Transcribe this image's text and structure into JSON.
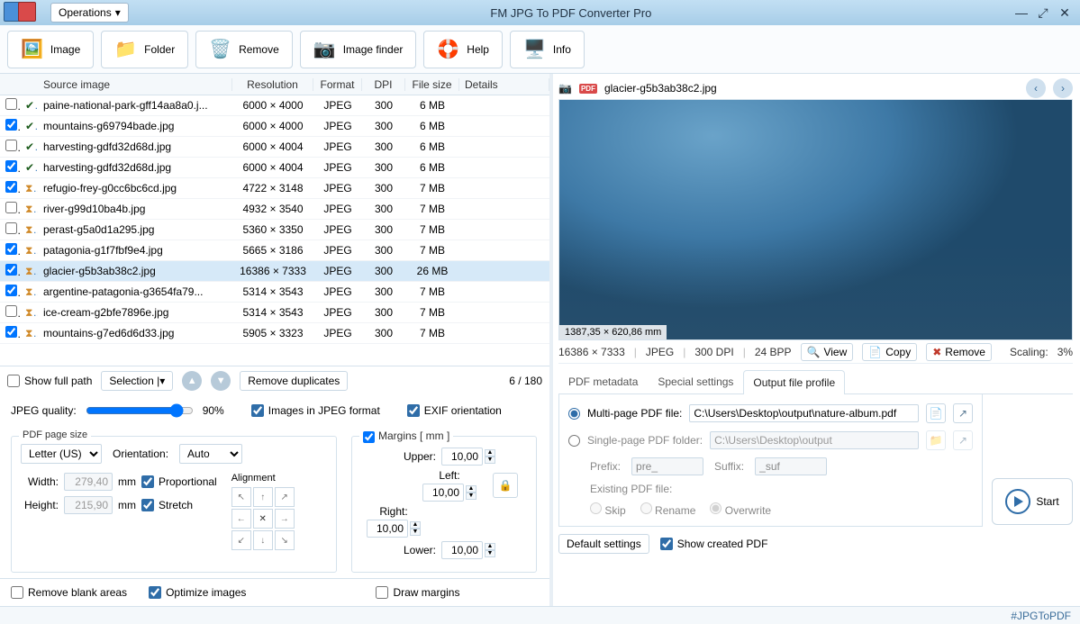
{
  "app": {
    "title": "FM JPG To PDF Converter Pro",
    "operations_btn": "Operations"
  },
  "toolbar": {
    "image": "Image",
    "folder": "Folder",
    "remove": "Remove",
    "finder": "Image finder",
    "help": "Help",
    "info": "Info"
  },
  "columns": {
    "source": "Source image",
    "resolution": "Resolution",
    "format": "Format",
    "dpi": "DPI",
    "size": "File size",
    "details": "Details"
  },
  "rows": [
    {
      "chk": false,
      "dup": true,
      "name": "paine-national-park-gff14aa8a0.j...",
      "res": "6000 × 4000",
      "fmt": "JPEG",
      "dpi": "300",
      "size": "6 MB",
      "sel": false
    },
    {
      "chk": true,
      "dup": true,
      "name": "mountains-g69794bade.jpg",
      "res": "6000 × 4000",
      "fmt": "JPEG",
      "dpi": "300",
      "size": "6 MB",
      "sel": false
    },
    {
      "chk": false,
      "dup": true,
      "name": "harvesting-gdfd32d68d.jpg",
      "res": "6000 × 4004",
      "fmt": "JPEG",
      "dpi": "300",
      "size": "6 MB",
      "sel": false
    },
    {
      "chk": true,
      "dup": true,
      "name": "harvesting-gdfd32d68d.jpg",
      "res": "6000 × 4004",
      "fmt": "JPEG",
      "dpi": "300",
      "size": "6 MB",
      "sel": false
    },
    {
      "chk": true,
      "dup": false,
      "name": "refugio-frey-g0cc6bc6cd.jpg",
      "res": "4722 × 3148",
      "fmt": "JPEG",
      "dpi": "300",
      "size": "7 MB",
      "sel": false
    },
    {
      "chk": false,
      "dup": false,
      "name": "river-g99d10ba4b.jpg",
      "res": "4932 × 3540",
      "fmt": "JPEG",
      "dpi": "300",
      "size": "7 MB",
      "sel": false
    },
    {
      "chk": false,
      "dup": false,
      "name": "perast-g5a0d1a295.jpg",
      "res": "5360 × 3350",
      "fmt": "JPEG",
      "dpi": "300",
      "size": "7 MB",
      "sel": false
    },
    {
      "chk": true,
      "dup": false,
      "name": "patagonia-g1f7fbf9e4.jpg",
      "res": "5665 × 3186",
      "fmt": "JPEG",
      "dpi": "300",
      "size": "7 MB",
      "sel": false
    },
    {
      "chk": true,
      "dup": false,
      "name": "glacier-g5b3ab38c2.jpg",
      "res": "16386 × 7333",
      "fmt": "JPEG",
      "dpi": "300",
      "size": "26 MB",
      "sel": true
    },
    {
      "chk": true,
      "dup": false,
      "name": "argentine-patagonia-g3654fa79...",
      "res": "5314 × 3543",
      "fmt": "JPEG",
      "dpi": "300",
      "size": "7 MB",
      "sel": false
    },
    {
      "chk": false,
      "dup": false,
      "name": "ice-cream-g2bfe7896e.jpg",
      "res": "5314 × 3543",
      "fmt": "JPEG",
      "dpi": "300",
      "size": "7 MB",
      "sel": false
    },
    {
      "chk": true,
      "dup": false,
      "name": "mountains-g7ed6d6d33.jpg",
      "res": "5905 × 3323",
      "fmt": "JPEG",
      "dpi": "300",
      "size": "7 MB",
      "sel": false
    }
  ],
  "listbar": {
    "full_path": "Show full path",
    "selection": "Selection",
    "remove_dup": "Remove duplicates",
    "counter": "6 / 180"
  },
  "quality": {
    "label": "JPEG quality:",
    "value": "90%",
    "jpeg_img": "Images in JPEG format",
    "exif": "EXIF orientation"
  },
  "page": {
    "legend": "PDF page size",
    "size": "Letter (US)",
    "orientation_lbl": "Orientation:",
    "orientation": "Auto",
    "width_lbl": "Width:",
    "width": "279,40",
    "height_lbl": "Height:",
    "height": "215,90",
    "unit": "mm",
    "proportional": "Proportional",
    "stretch": "Stretch",
    "align_lbl": "Alignment"
  },
  "margins": {
    "legend": "Margins [ mm ]",
    "upper_lbl": "Upper:",
    "upper": "10,00",
    "left_lbl": "Left:",
    "left": "10,00",
    "right_lbl": "Right:",
    "right": "10,00",
    "lower_lbl": "Lower:",
    "lower": "10,00"
  },
  "leftbottom": {
    "blank": "Remove blank areas",
    "optimize": "Optimize images",
    "draw": "Draw margins"
  },
  "preview": {
    "filename": "glacier-g5b3ab38c2.jpg",
    "dim_badge": "1387,35 × 620,86 mm",
    "info": "16386 × 7333",
    "fmt": "JPEG",
    "dpi": "300 DPI",
    "bpp": "24 BPP",
    "view": "View",
    "copy": "Copy",
    "remove": "Remove",
    "scaling_lbl": "Scaling:",
    "scaling": "3%"
  },
  "tabs": {
    "meta": "PDF metadata",
    "special": "Special settings",
    "output": "Output file profile"
  },
  "output": {
    "multi_lbl": "Multi-page PDF file:",
    "multi_path": "C:\\Users\\Desktop\\output\\nature-album.pdf",
    "single_lbl": "Single-page PDF folder:",
    "single_path": "C:\\Users\\Desktop\\output",
    "prefix_lbl": "Prefix:",
    "prefix": "pre_",
    "suffix_lbl": "Suffix:",
    "suffix": "_suf",
    "existing_lbl": "Existing PDF file:",
    "skip": "Skip",
    "rename": "Rename",
    "overwrite": "Overwrite",
    "defaults": "Default settings",
    "show_created": "Show created PDF",
    "start": "Start"
  },
  "footer": {
    "hashtag": "#JPGToPDF"
  }
}
